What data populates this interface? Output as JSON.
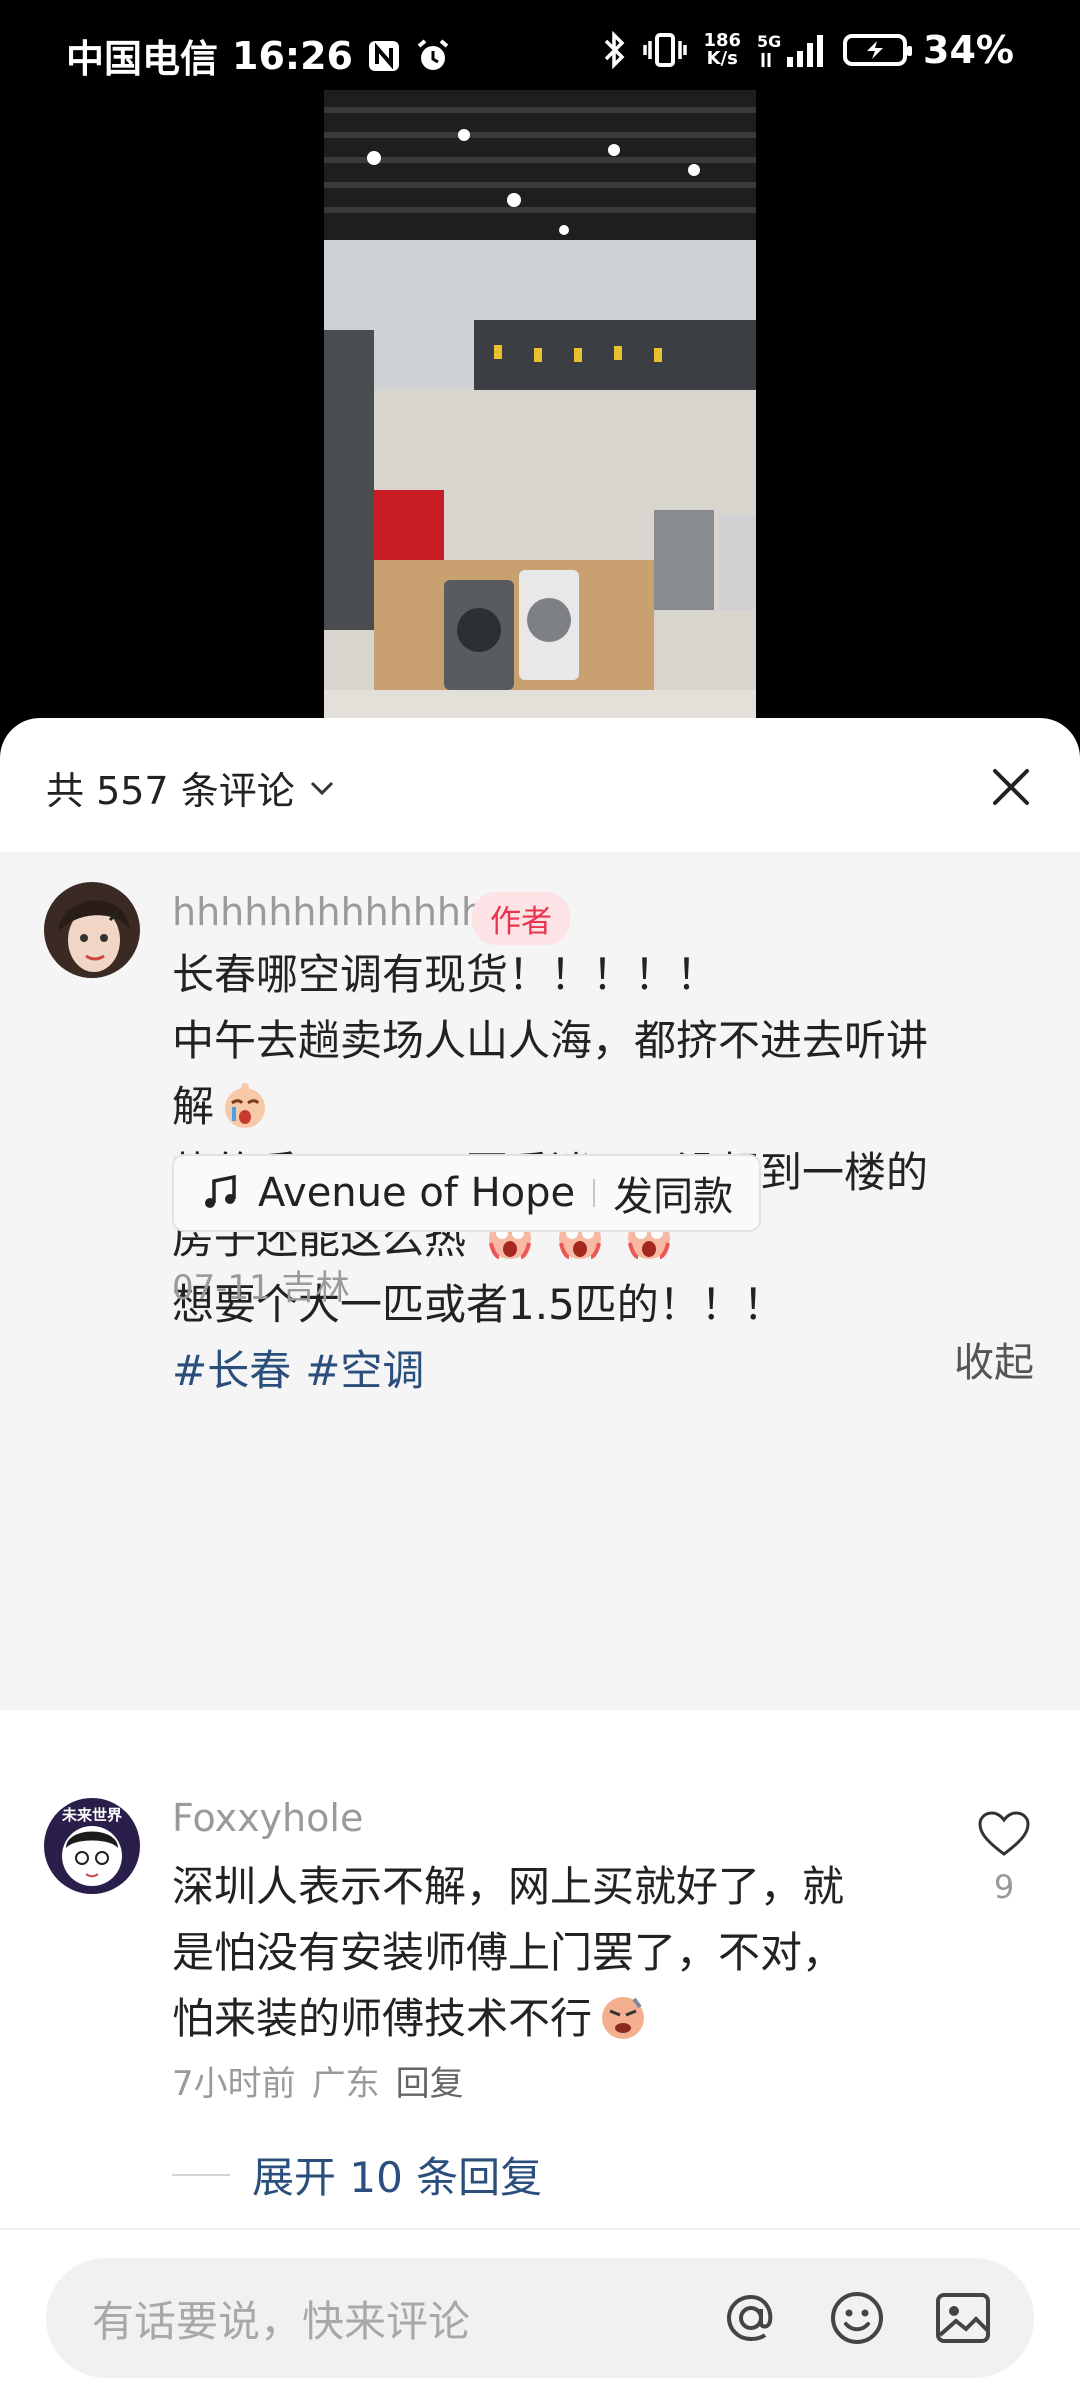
{
  "status_bar": {
    "carrier": "中国电信",
    "time": "16:26",
    "net_speed_value": "186",
    "net_speed_unit": "K/s",
    "network": "5G",
    "battery": "34%"
  },
  "comments_panel": {
    "count_label": "共 557 条评论",
    "author_comment": {
      "username": "hhhhhhhhhhhhhh",
      "badge": "作者",
      "lines": [
        "长春哪空调有现货！！！！！",
        "中午去趟卖场人山人海，都挤不进去听讲",
        "解",
        "热的受不了了，要昏迷了。没想到一楼的",
        "房子还能这么热",
        "想要个大一匹或者1.5匹的！！！"
      ],
      "hashtags": [
        "#长春",
        "#空调"
      ],
      "music": {
        "title": "Avenue of Hope",
        "action": "发同款"
      },
      "meta": "07-11 吉林",
      "collapse_label": "收起"
    },
    "comment2": {
      "username": "Foxxyhole",
      "avatar_text": "未来世界",
      "lines": [
        "深圳人表示不解，网上买就好了，就",
        "是怕没有安装师傅上门罢了，不对，",
        "怕来装的师傅技术不行"
      ],
      "time": "7小时前",
      "location": "广东",
      "reply_label": "回复",
      "like_count": "9",
      "expand_label": "展开 10 条回复"
    },
    "input": {
      "placeholder": "有话要说，快来评论"
    }
  }
}
